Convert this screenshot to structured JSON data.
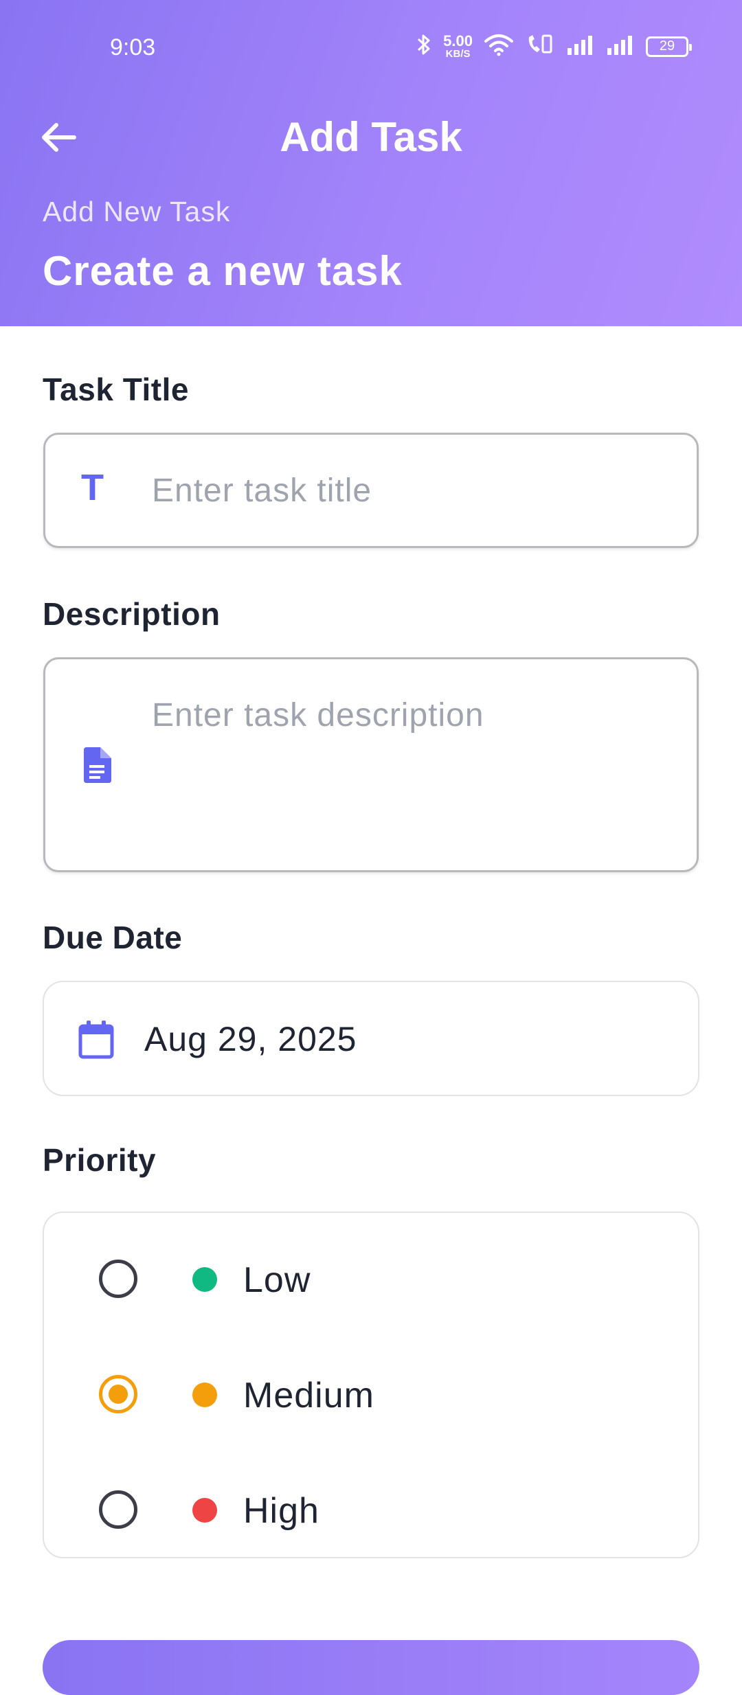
{
  "status_bar": {
    "time": "9:03",
    "net_speed_value": "5.00",
    "net_speed_unit": "KB/S",
    "battery": "29"
  },
  "app_bar": {
    "title": "Add Task",
    "back_icon": "arrow-left-icon"
  },
  "header": {
    "subtitle": "Add New Task",
    "heading": "Create a new task"
  },
  "form": {
    "title_label": "Task Title",
    "title_placeholder": "Enter task title",
    "title_icon": "T",
    "description_label": "Description",
    "description_placeholder": "Enter task description",
    "due_date_label": "Due Date",
    "due_date_value": "Aug 29, 2025",
    "priority_label": "Priority",
    "priorities": [
      {
        "label": "Low",
        "color": "#10b981",
        "selected": false
      },
      {
        "label": "Medium",
        "color": "#f59e0b",
        "selected": true
      },
      {
        "label": "High",
        "color": "#ef4444",
        "selected": false
      }
    ]
  },
  "colors": {
    "accent": "#6366f1",
    "header_start": "#8a74f2",
    "header_end": "#b08cfd"
  }
}
